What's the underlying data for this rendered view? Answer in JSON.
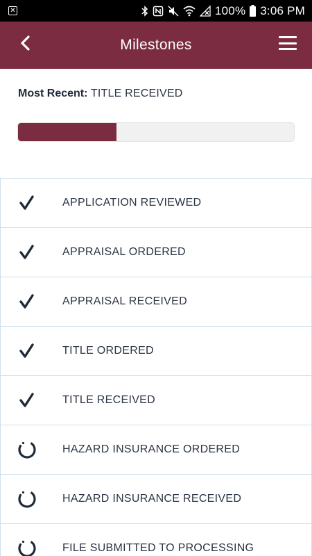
{
  "status_bar": {
    "battery": "100%",
    "time": "3:06 PM",
    "icons": [
      "close-box-icon",
      "bluetooth-icon",
      "nfc-icon",
      "mute-icon",
      "wifi-icon",
      "no-signal-icon",
      "battery-icon"
    ]
  },
  "app_bar": {
    "title": "Milestones",
    "back_icon": "chevron-left-icon",
    "menu_icon": "hamburger-menu-icon",
    "color": "#7b2c40"
  },
  "most_recent": {
    "label": "Most Recent:",
    "value": "TITLE RECEIVED"
  },
  "progress": {
    "fraction": 0.357,
    "color": "#7b2c40"
  },
  "milestones": [
    {
      "label": "APPLICATION REVIEWED",
      "status": "complete",
      "icon": "checkmark-icon"
    },
    {
      "label": "APPRAISAL ORDERED",
      "status": "complete",
      "icon": "checkmark-icon"
    },
    {
      "label": "APPRAISAL RECEIVED",
      "status": "complete",
      "icon": "checkmark-icon"
    },
    {
      "label": "TITLE ORDERED",
      "status": "complete",
      "icon": "checkmark-icon"
    },
    {
      "label": "TITLE RECEIVED",
      "status": "complete",
      "icon": "checkmark-icon"
    },
    {
      "label": "HAZARD INSURANCE ORDERED",
      "status": "pending",
      "icon": "pending-circle-icon"
    },
    {
      "label": "HAZARD INSURANCE RECEIVED",
      "status": "pending",
      "icon": "pending-circle-icon"
    },
    {
      "label": "FILE SUBMITTED TO PROCESSING",
      "status": "pending",
      "icon": "pending-circle-icon"
    }
  ]
}
